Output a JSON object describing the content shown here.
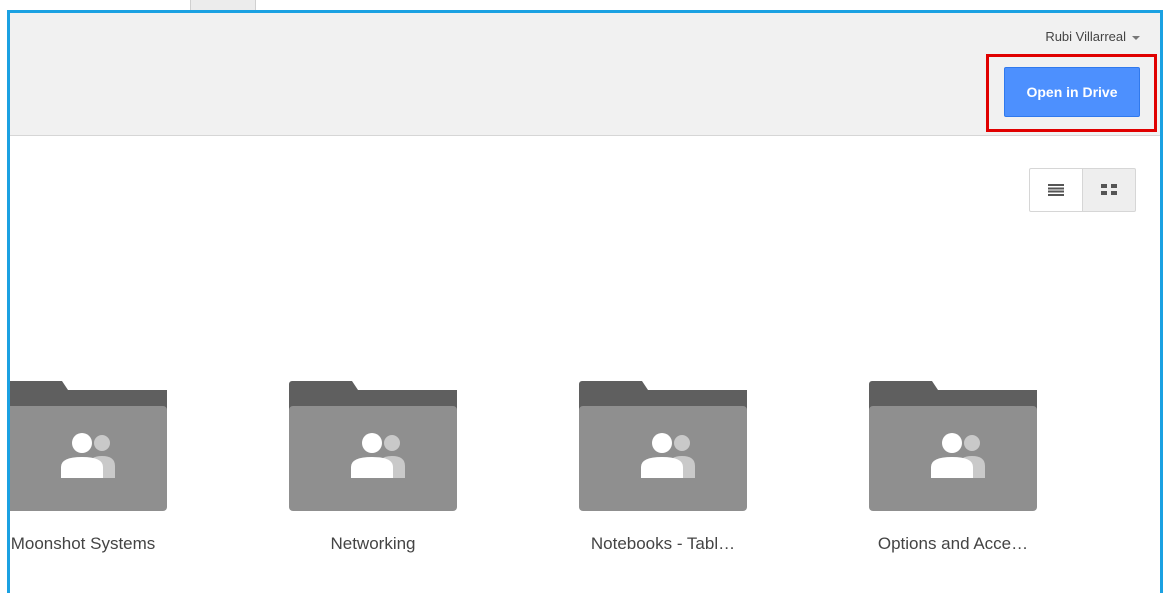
{
  "header": {
    "user_name": "Rubi Villarreal",
    "open_button_label": "Open in Drive"
  },
  "view_toggle": {
    "list_icon": "list-view-icon",
    "grid_icon": "grid-view-icon",
    "selected": "grid"
  },
  "folders": [
    {
      "label": "Moonshot Systems",
      "icon": "shared-folder-icon"
    },
    {
      "label": "Networking",
      "icon": "shared-folder-icon"
    },
    {
      "label": "Notebooks - Tabl…",
      "icon": "shared-folder-icon"
    },
    {
      "label": "Options and Acce…",
      "icon": "shared-folder-icon"
    }
  ],
  "colors": {
    "frame_border": "#1ba1e2",
    "highlight_border": "#e00000",
    "primary_button": "#4d90fe",
    "folder_tab": "#5f5f5f",
    "folder_body": "#8f8f8f"
  }
}
